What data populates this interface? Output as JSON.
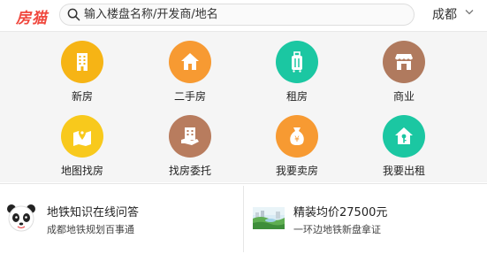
{
  "header": {
    "logo_text": "房猫",
    "search_placeholder": "输入楼盘名称/开发商/地名",
    "city": "成都",
    "brand_color": "#f0483e"
  },
  "categories": [
    {
      "label": "新房",
      "icon": "building-icon",
      "color": "#f6b415"
    },
    {
      "label": "二手房",
      "icon": "house-icon",
      "color": "#f79a32"
    },
    {
      "label": "租房",
      "icon": "luggage-icon",
      "color": "#1bc7a2"
    },
    {
      "label": "商业",
      "icon": "shop-icon",
      "color": "#b07a5e"
    },
    {
      "label": "地图找房",
      "icon": "map-pin-icon",
      "color": "#f8c91c"
    },
    {
      "label": "找房委托",
      "icon": "handshake-building-icon",
      "color": "#b87c5e"
    },
    {
      "label": "我要卖房",
      "icon": "money-bag-icon",
      "color": "#f79a32"
    },
    {
      "label": "我要出租",
      "icon": "house-key-icon",
      "color": "#1bc7a2"
    }
  ],
  "cards": [
    {
      "title": "地铁知识在线问答",
      "subtitle": "成都地铁规划百事通",
      "icon": "panda-icon"
    },
    {
      "title": "精装均价27500元",
      "subtitle": "一环边地铁新盘拿证",
      "icon": "landscape-thumbnail-icon"
    }
  ]
}
